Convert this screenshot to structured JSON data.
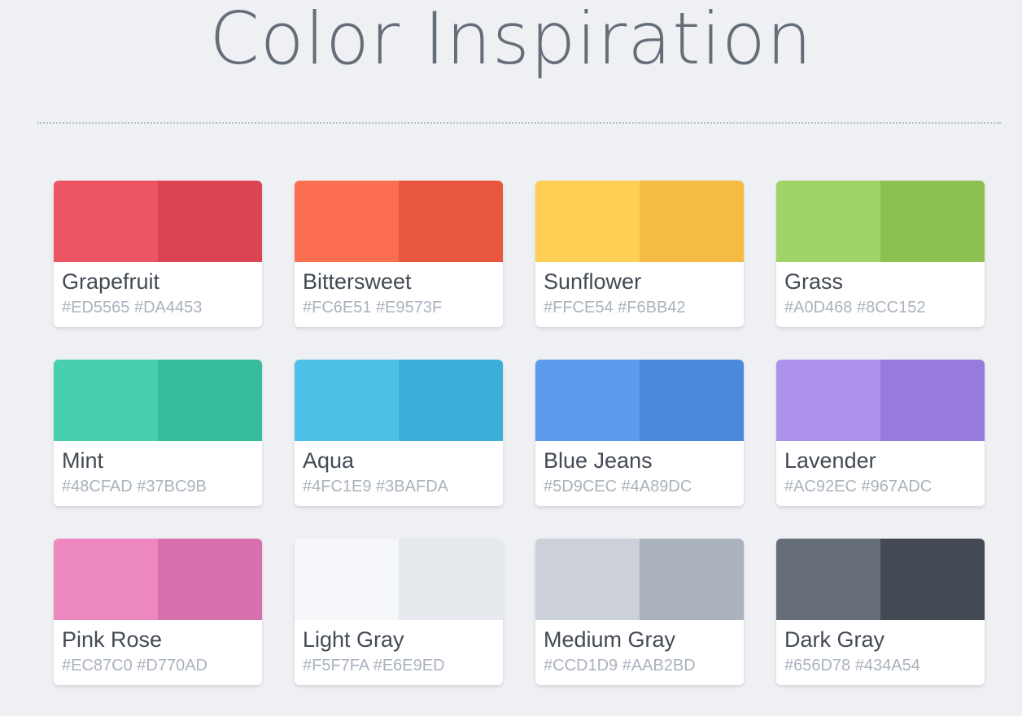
{
  "page": {
    "title": "Color Inspiration"
  },
  "palettes": [
    {
      "name": "Grapefruit",
      "color1": "#ED5565",
      "color2": "#DA4453",
      "hex_label": "#ED5565 #DA4453"
    },
    {
      "name": "Bittersweet",
      "color1": "#FC6E51",
      "color2": "#E9573F",
      "hex_label": "#FC6E51 #E9573F"
    },
    {
      "name": "Sunflower",
      "color1": "#FFCE54",
      "color2": "#F6BB42",
      "hex_label": "#FFCE54 #F6BB42"
    },
    {
      "name": "Grass",
      "color1": "#A0D468",
      "color2": "#8CC152",
      "hex_label": "#A0D468 #8CC152"
    },
    {
      "name": "Mint",
      "color1": "#48CFAD",
      "color2": "#37BC9B",
      "hex_label": "#48CFAD #37BC9B"
    },
    {
      "name": "Aqua",
      "color1": "#4FC1E9",
      "color2": "#3BAFDA",
      "hex_label": "#4FC1E9 #3BAFDA"
    },
    {
      "name": "Blue Jeans",
      "color1": "#5D9CEC",
      "color2": "#4A89DC",
      "hex_label": "#5D9CEC #4A89DC"
    },
    {
      "name": "Lavender",
      "color1": "#AC92EC",
      "color2": "#967ADC",
      "hex_label": "#AC92EC #967ADC"
    },
    {
      "name": "Pink Rose",
      "color1": "#EC87C0",
      "color2": "#D770AD",
      "hex_label": "#EC87C0 #D770AD"
    },
    {
      "name": "Light Gray",
      "color1": "#F5F7FA",
      "color2": "#E6E9ED",
      "hex_label": "#F5F7FA #E6E9ED"
    },
    {
      "name": "Medium Gray",
      "color1": "#CCD1D9",
      "color2": "#AAB2BD",
      "hex_label": "#CCD1D9 #AAB2BD"
    },
    {
      "name": "Dark Gray",
      "color1": "#656D78",
      "color2": "#434A54",
      "hex_label": "#656D78 #434A54"
    }
  ]
}
